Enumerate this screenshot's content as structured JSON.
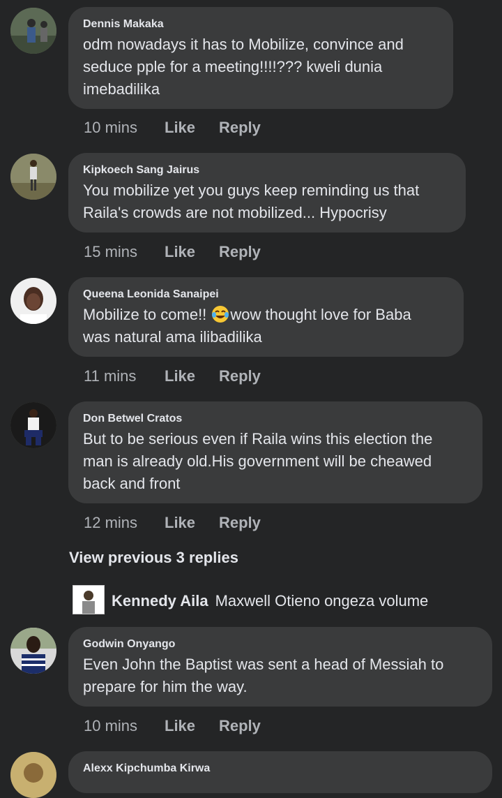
{
  "comments": [
    {
      "author": "Dennis Makaka",
      "lines": [
        "odm nowadays it has to Mobilize, convince and",
        "seduce pple for a meeting!!!!??? kweli dunia",
        "imebadilika"
      ],
      "time": "10 mins",
      "like": "Like",
      "reply": "Reply"
    },
    {
      "author": "Kipkoech Sang Jairus",
      "lines": [
        "You mobilize yet you guys keep reminding us that",
        "Raila's crowds are not mobilized... Hypocrisy"
      ],
      "time": "15 mins",
      "like": "Like",
      "reply": "Reply"
    },
    {
      "author": "Queena Leonida Sanaipei",
      "line1_before": "Mobilize to come!! ",
      "emoji": "tears-of-joy-emoji",
      "line1_after": "wow thought love for Baba",
      "line2": "was natural ama ilibadilika",
      "time": "11 mins",
      "like": "Like",
      "reply": "Reply"
    },
    {
      "author": "Don Betwel Cratos",
      "lines": [
        "But to be serious even if Raila wins this election the",
        "man is already old.His government will be cheawed",
        "back and front"
      ],
      "time": "12 mins",
      "like": "Like",
      "reply": "Reply"
    },
    {
      "author": "Godwin Onyango",
      "lines": [
        "Even John the Baptist was sent a head of Messiah to",
        "prepare for him the way."
      ],
      "time": "10 mins",
      "like": "Like",
      "reply": "Reply"
    },
    {
      "author": "Alexx Kipchumba Kirwa"
    }
  ],
  "view_previous": "View previous 3 replies",
  "nested_reply": {
    "author": "Kennedy Aila",
    "text": "Maxwell Otieno ongeza volume"
  },
  "colors": {
    "background": "#242526",
    "bubble": "#3a3b3c",
    "text": "#e4e6eb",
    "meta": "#b0b3b8"
  }
}
